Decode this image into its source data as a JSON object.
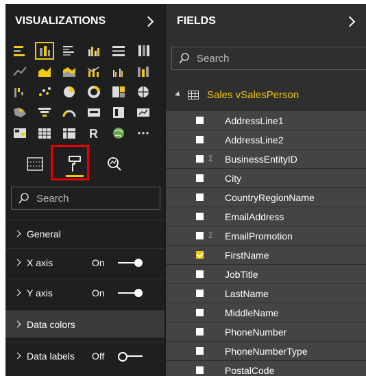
{
  "visualizations": {
    "title": "VISUALIZATIONS",
    "search_placeholder": "Search",
    "sections": [
      {
        "label": "General",
        "state": ""
      },
      {
        "label": "X axis",
        "state": "On"
      },
      {
        "label": "Y axis",
        "state": "On"
      },
      {
        "label": "Data colors",
        "state": ""
      },
      {
        "label": "Data labels",
        "state": "Off"
      }
    ]
  },
  "fields": {
    "title": "FIELDS",
    "search_placeholder": "Search",
    "table_name": "Sales vSalesPerson",
    "items": [
      {
        "name": "AddressLine1",
        "sigma": false,
        "checked": false
      },
      {
        "name": "AddressLine2",
        "sigma": false,
        "checked": false
      },
      {
        "name": "BusinessEntityID",
        "sigma": true,
        "checked": false
      },
      {
        "name": "City",
        "sigma": false,
        "checked": false
      },
      {
        "name": "CountryRegionName",
        "sigma": false,
        "checked": false
      },
      {
        "name": "EmailAddress",
        "sigma": false,
        "checked": false
      },
      {
        "name": "EmailPromotion",
        "sigma": true,
        "checked": false
      },
      {
        "name": "FirstName",
        "sigma": false,
        "checked": true
      },
      {
        "name": "JobTitle",
        "sigma": false,
        "checked": false
      },
      {
        "name": "LastName",
        "sigma": false,
        "checked": false
      },
      {
        "name": "MiddleName",
        "sigma": false,
        "checked": false
      },
      {
        "name": "PhoneNumber",
        "sigma": false,
        "checked": false
      },
      {
        "name": "PhoneNumberType",
        "sigma": false,
        "checked": false
      },
      {
        "name": "PostalCode",
        "sigma": false,
        "checked": false
      }
    ]
  },
  "colors": {
    "accent": "#f2c811",
    "highlight_box": "#e60000"
  }
}
